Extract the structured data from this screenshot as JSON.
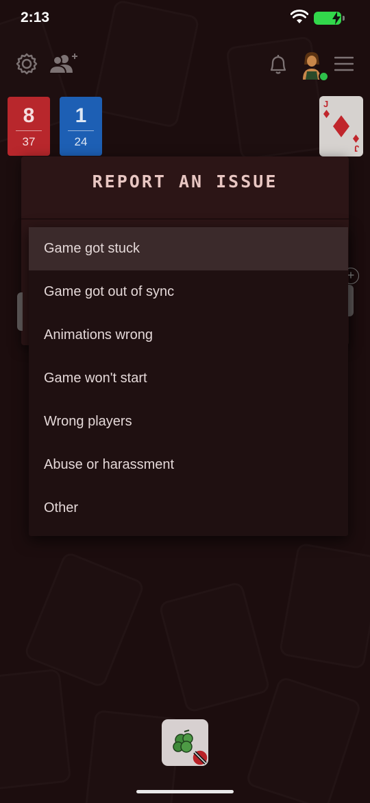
{
  "status_bar": {
    "time": "2:13"
  },
  "top_bar": {
    "icons": [
      "gear-icon",
      "add-friends-icon",
      "bell-icon",
      "avatar",
      "hamburger-menu-icon"
    ]
  },
  "scores": [
    {
      "score": "8",
      "total": "37",
      "color": "#b8272c"
    },
    {
      "score": "1",
      "total": "24",
      "color": "#1d5fb4"
    }
  ],
  "top_card": {
    "rank": "J",
    "suit": "diamonds"
  },
  "dialog": {
    "title": "REPORT AN ISSUE"
  },
  "menu": {
    "selected_index": 0,
    "items": [
      "Game got stuck",
      "Game got out of sync",
      "Animations wrong",
      "Game won't start",
      "Wrong players",
      "Abuse or harassment",
      "Other"
    ]
  },
  "colors": {
    "background": "#1c0d0e",
    "dialog": "#2c1516",
    "menu": "#1f1011",
    "menu_selected": "#3b2a2b",
    "title": "#e8c6c2"
  }
}
